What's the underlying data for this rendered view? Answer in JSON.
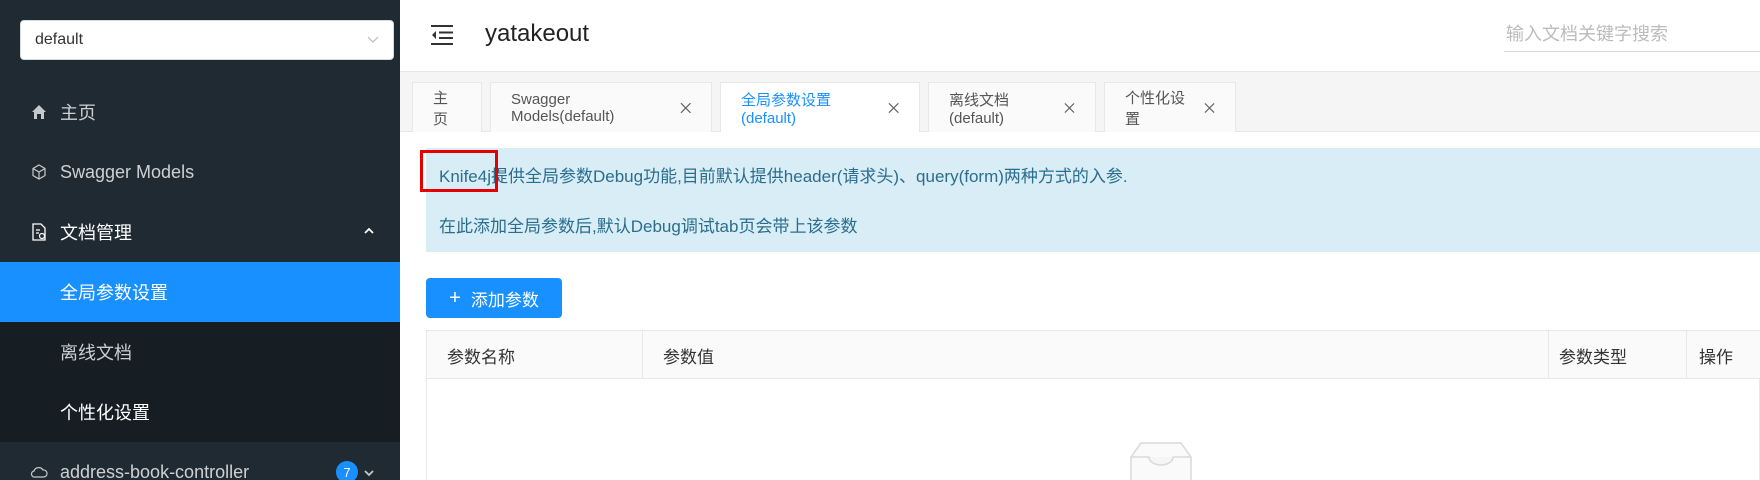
{
  "sidebar": {
    "group_select": "default",
    "items": [
      {
        "label": "主页"
      },
      {
        "label": "Swagger Models"
      },
      {
        "label": "文档管理"
      },
      {
        "label": "全局参数设置"
      },
      {
        "label": "离线文档"
      },
      {
        "label": "个性化设置"
      },
      {
        "label": "address-book-controller",
        "badge": "7"
      }
    ]
  },
  "header": {
    "title": "yatakeout",
    "search_placeholder": "输入文档关键字搜索"
  },
  "tabs": [
    {
      "label": "主页"
    },
    {
      "label": "Swagger Models(default)"
    },
    {
      "label": "全局参数设置(default)"
    },
    {
      "label": "离线文档(default)"
    },
    {
      "label": "个性化设置"
    }
  ],
  "content": {
    "alert_line1": "Knife4j提供全局参数Debug功能,目前默认提供header(请求头)、query(form)两种方式的入参.",
    "alert_line2": "在此添加全局参数后,默认Debug调试tab页会带上该参数",
    "add_button": "添加参数",
    "table_headers": [
      "参数名称",
      "参数值",
      "参数类型",
      "操作"
    ]
  },
  "colors": {
    "accent": "#1890ff",
    "sidebar_bg": "#1f2a33",
    "alert_bg": "#d8edf5",
    "highlight": "#e60000"
  }
}
